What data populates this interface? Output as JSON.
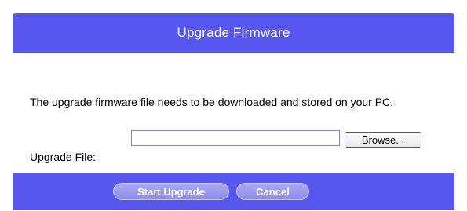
{
  "header": {
    "title": "Upgrade Firmware"
  },
  "description": "The upgrade firmware file needs to be downloaded and stored on your PC.",
  "upgrade_file": {
    "label": "Upgrade File:",
    "value": "",
    "browse_label": "Browse..."
  },
  "footer": {
    "start_label": "Start Upgrade",
    "cancel_label": "Cancel"
  },
  "colors": {
    "accent": "#5557ee",
    "button_fill": "#9c9df0"
  }
}
